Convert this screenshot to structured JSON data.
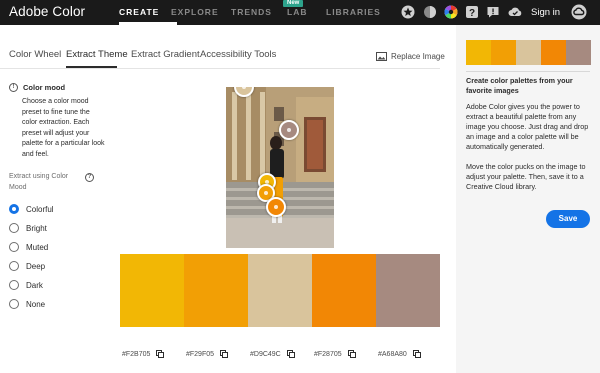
{
  "nav": {
    "brand": "Adobe Color",
    "links": [
      "CREATE",
      "EXPLORE",
      "TRENDS",
      "LAB",
      "LIBRARIES"
    ],
    "badge": "New",
    "signin": "Sign in",
    "icons": [
      "star-icon",
      "contrast-icon",
      "color-wheel-icon",
      "help-icon",
      "feedback-icon",
      "creative-cloud-files-icon",
      "creative-cloud-icon"
    ]
  },
  "tabs": [
    "Color Wheel",
    "Extract Theme",
    "Extract Gradient",
    "Accessibility Tools"
  ],
  "active_tab": "Extract Theme",
  "replace_image": "Replace Image",
  "left": {
    "mood_title": "Color mood",
    "mood_desc": "Choose a color mood preset to fine tune the color extraction. Each preset will adjust your palette for a particular look and feel.",
    "extract_label": "Extract using Color Mood",
    "options": [
      "Colorful",
      "Bright",
      "Muted",
      "Deep",
      "Dark",
      "None"
    ],
    "selected": "Colorful"
  },
  "palette": [
    {
      "hex": "#F2B705"
    },
    {
      "hex": "#F29F05"
    },
    {
      "hex": "#D9C49C"
    },
    {
      "hex": "#F28705"
    },
    {
      "hex": "#A68A80"
    }
  ],
  "right": {
    "title": "Create color palettes from your favorite images",
    "para1": "Adobe Color gives you the power to extract a beautiful palette from any image you choose. Just drag and drop an image and a color palette will be automatically generated.",
    "para2": "Move the color pucks on the image to adjust your palette. Then, save it to a Creative Cloud library.",
    "save": "Save"
  }
}
